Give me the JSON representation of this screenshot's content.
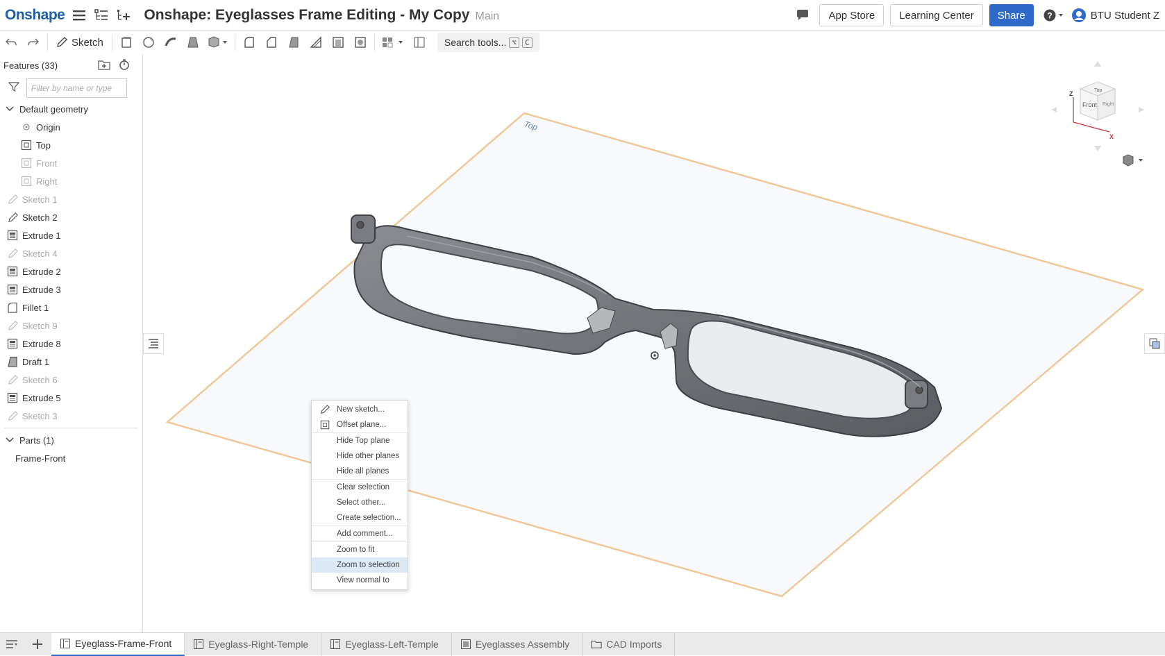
{
  "header": {
    "logo": "Onshape",
    "doc_title": "Onshape: Eyeglasses Frame Editing - My Copy",
    "branch": "Main",
    "app_store": "App Store",
    "learning_center": "Learning Center",
    "share": "Share",
    "user": "BTU Student Z"
  },
  "toolbar": {
    "sketch_label": "Sketch",
    "search_label": "Search tools...",
    "shortcut_1": "⌥",
    "shortcut_2": "C"
  },
  "features": {
    "title": "Features (33)",
    "filter_placeholder": "Filter by name or type",
    "default_geometry": "Default geometry",
    "geometry_items": [
      {
        "label": "Origin",
        "icon": "origin-icon",
        "dim": false
      },
      {
        "label": "Top",
        "icon": "plane-icon",
        "dim": false
      },
      {
        "label": "Front",
        "icon": "plane-icon",
        "dim": true
      },
      {
        "label": "Right",
        "icon": "plane-icon",
        "dim": true
      }
    ],
    "items": [
      {
        "label": "Sketch 1",
        "icon": "sketch-icon",
        "dim": true
      },
      {
        "label": "Sketch 2",
        "icon": "sketch-icon",
        "dim": false
      },
      {
        "label": "Extrude 1",
        "icon": "extrude-icon",
        "dim": false
      },
      {
        "label": "Sketch 4",
        "icon": "sketch-icon",
        "dim": true
      },
      {
        "label": "Extrude 2",
        "icon": "extrude-icon",
        "dim": false
      },
      {
        "label": "Extrude 3",
        "icon": "extrude-icon",
        "dim": false
      },
      {
        "label": "Fillet 1",
        "icon": "fillet-icon",
        "dim": false
      },
      {
        "label": "Sketch 9",
        "icon": "sketch-icon",
        "dim": true
      },
      {
        "label": "Extrude 8",
        "icon": "extrude-icon",
        "dim": false
      },
      {
        "label": "Draft 1",
        "icon": "draft-icon",
        "dim": false
      },
      {
        "label": "Sketch 6",
        "icon": "sketch-icon",
        "dim": true
      },
      {
        "label": "Extrude 5",
        "icon": "extrude-icon",
        "dim": false
      },
      {
        "label": "Sketch 3",
        "icon": "sketch-icon",
        "dim": true
      }
    ],
    "parts_title": "Parts (1)",
    "parts": [
      "Frame-Front"
    ]
  },
  "viewport": {
    "plane_label": "Top",
    "viewcube": {
      "top": "Top",
      "front": "Front",
      "right": "Right",
      "z": "Z",
      "x": "X"
    }
  },
  "context_menu": {
    "groups": [
      [
        {
          "label": "New sketch...",
          "icon": "pencil-icon"
        },
        {
          "label": "Offset plane...",
          "icon": "plane-icon"
        }
      ],
      [
        {
          "label": "Hide Top plane"
        },
        {
          "label": "Hide other planes"
        },
        {
          "label": "Hide all planes"
        }
      ],
      [
        {
          "label": "Clear selection"
        },
        {
          "label": "Select other..."
        },
        {
          "label": "Create selection..."
        }
      ],
      [
        {
          "label": "Add comment..."
        }
      ],
      [
        {
          "label": "Zoom to fit"
        },
        {
          "label": "Zoom to selection",
          "highlighted": true
        },
        {
          "label": "View normal to"
        }
      ]
    ]
  },
  "tabs": [
    {
      "label": "Eyeglass-Frame-Front",
      "icon": "part-studio-icon",
      "active": true
    },
    {
      "label": "Eyeglass-Right-Temple",
      "icon": "part-studio-icon",
      "active": false
    },
    {
      "label": "Eyeglass-Left-Temple",
      "icon": "part-studio-icon",
      "active": false
    },
    {
      "label": "Eyeglasses Assembly",
      "icon": "assembly-icon",
      "active": false
    },
    {
      "label": "CAD Imports",
      "icon": "folder-icon",
      "active": false
    }
  ],
  "colors": {
    "accent": "#2f69c9",
    "logo": "#1f5fa8",
    "plane_edge": "#f0c89a",
    "plane_fill": "#f7f9fc",
    "frame": "#6e7075"
  }
}
